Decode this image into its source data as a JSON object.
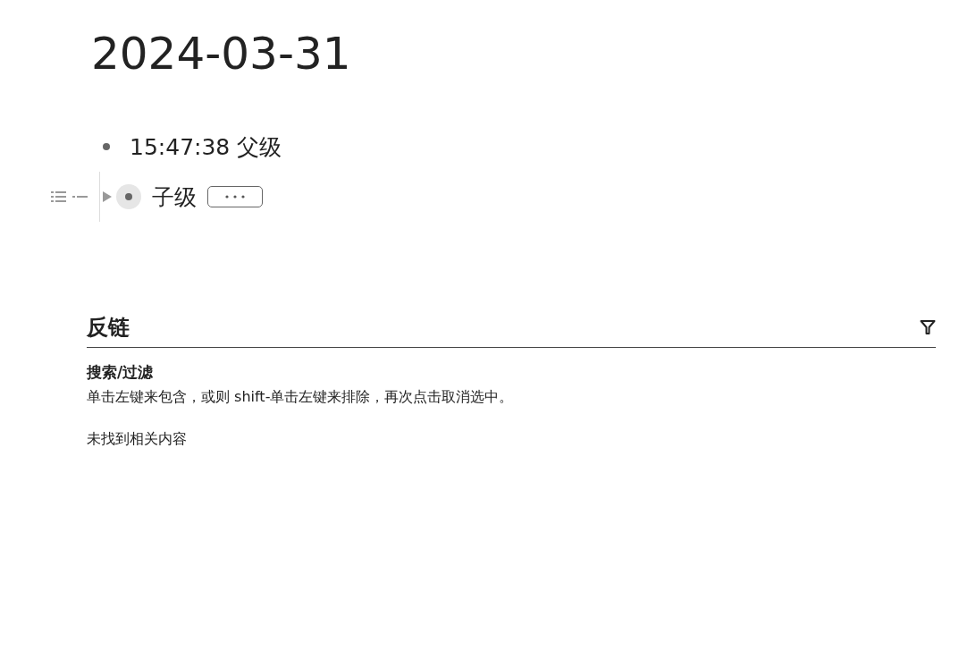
{
  "page": {
    "title": "2024-03-31"
  },
  "blocks": [
    {
      "text": "15:47:38 父级",
      "collapsed": false,
      "children": [
        {
          "text": "子级",
          "collapsed": true,
          "hovered": true
        }
      ]
    }
  ],
  "backlinks": {
    "title": "反链",
    "filter_heading": "搜索/过滤",
    "filter_hint": "单击左键来包含，或则 shift-单击左键来排除，再次点击取消选中。",
    "empty_message": "未找到相关内容"
  }
}
